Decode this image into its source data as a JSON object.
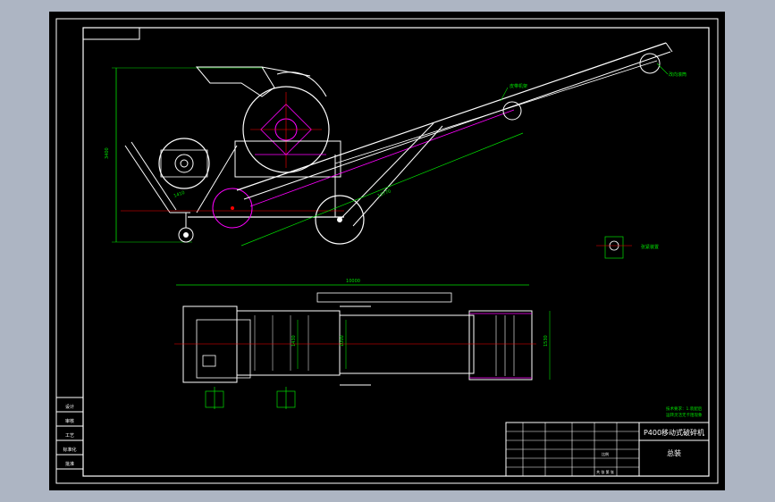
{
  "title_block": {
    "drawing_title": "P400移动式破碎机",
    "drawing_subtitle": "总装",
    "row_labels_left": [
      "设计",
      "审核",
      "工艺",
      "标准化",
      "批准"
    ],
    "scale_label": "比例",
    "sheet_label": "共 张 第 张"
  },
  "dimensions": {
    "height_total": "3400",
    "side_small": "1410",
    "conveyor_len": "13770",
    "top_length": "10000",
    "w1": "1430",
    "w2": "1000",
    "w3": "1530"
  },
  "annotations": {
    "belt_label": "皮带机架",
    "roller_label": "改向滚筒",
    "detail_label": "张紧装置",
    "note_line1": "技术要求：1.装配后",
    "note_line2": "运转灵活无卡阻现象"
  },
  "colors": {
    "background": "#000000",
    "frame": "#ffffff",
    "dimension": "#00e000",
    "part_outline": "#ffffff",
    "center_line": "#ff0000",
    "hidden": "#ff00ff",
    "accent_blue": "#4a6fd1"
  }
}
